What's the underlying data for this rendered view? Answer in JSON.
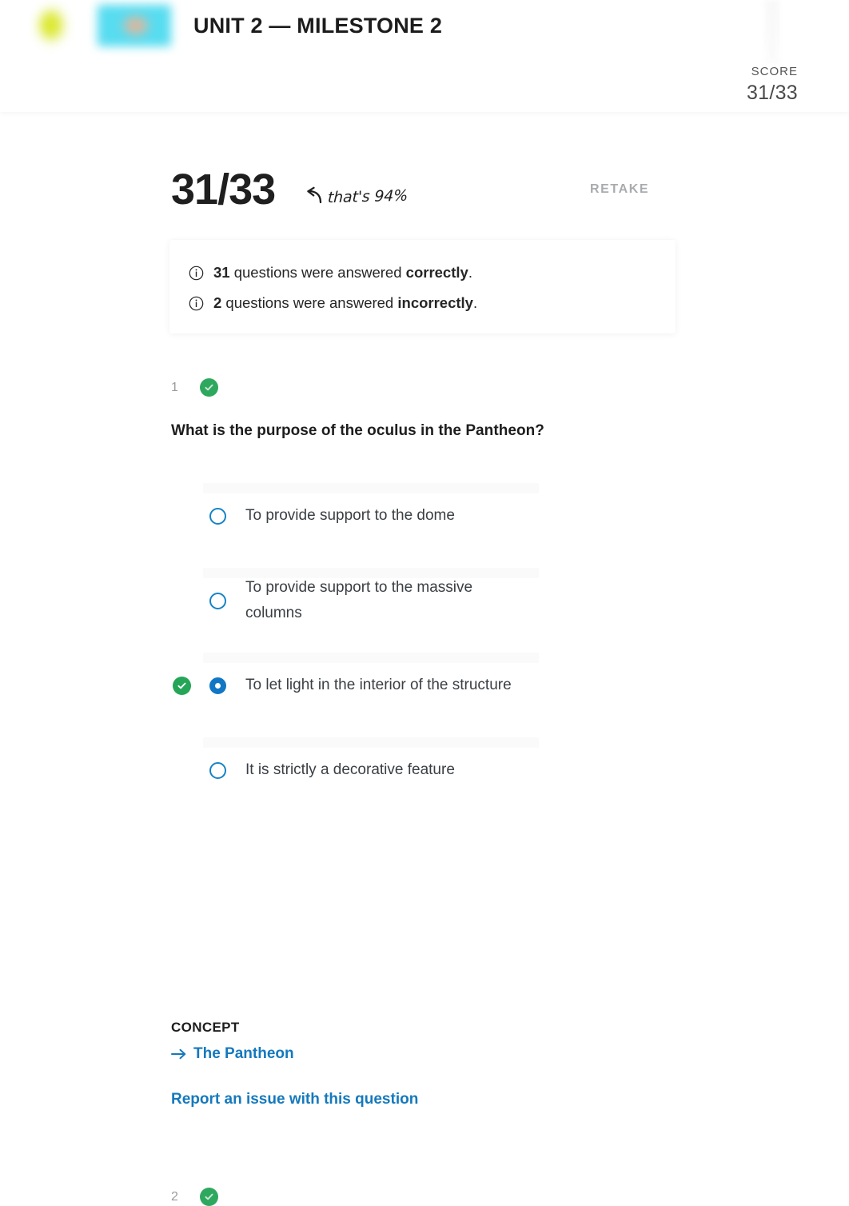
{
  "header": {
    "title": "UNIT 2 — MILESTONE 2",
    "score_label": "SCORE",
    "score_value": "31/33",
    "logo_yellow_color": "#d9e622",
    "logo_cyan_color": "#57dcf0"
  },
  "summary": {
    "big_score": "31/33",
    "annotation": "that's 94%",
    "retake_label": "RETAKE",
    "info": [
      {
        "count": "31",
        "middle": " questions were answered ",
        "emphasis": "correctly",
        "period": "."
      },
      {
        "count": "2",
        "middle": " questions were answered ",
        "emphasis": "incorrectly",
        "period": "."
      }
    ]
  },
  "question": {
    "number": "1",
    "status": "correct",
    "text": "What is the purpose of the oculus in the Pantheon?",
    "options": [
      {
        "label": "To provide support to the dome",
        "selected": false,
        "is_correct": false
      },
      {
        "label": "To provide support to the massive columns",
        "selected": false,
        "is_correct": false
      },
      {
        "label": "To let light in the interior of the structure",
        "selected": true,
        "is_correct": true
      },
      {
        "label": "It is strictly a decorative feature",
        "selected": false,
        "is_correct": false
      }
    ],
    "concept_heading": "CONCEPT",
    "concept_link": "The Pantheon",
    "report_link": "Report an issue with this question"
  },
  "next_question": {
    "number": "2",
    "status": "correct"
  },
  "colors": {
    "link_blue": "#1479bd",
    "radio_blue": "#1683c7",
    "selected_blue": "#1177c4",
    "correct_green": "#24a557",
    "retake_grey": "#a9acae",
    "text_dark": "#1d1d1d"
  }
}
